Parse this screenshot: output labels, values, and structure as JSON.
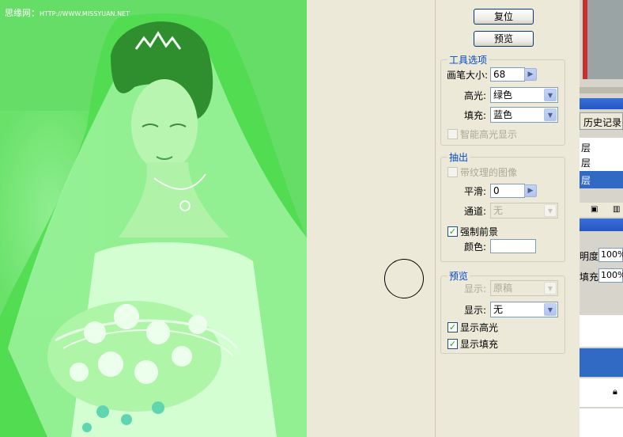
{
  "canvas": {
    "watermark_name": "思缘网：",
    "watermark_url": "HTTP://WWW.MISSYUAN.NET"
  },
  "dialog": {
    "reset_label": "复位",
    "preview_label": "预览",
    "tool_options": {
      "title": "工具选项",
      "brush_size_label": "画笔大小:",
      "brush_size_value": "68",
      "highlight_label": "高光:",
      "highlight_value": "绿色",
      "fill_label": "填充:",
      "fill_value": "蓝色",
      "smart_highlight_label": "智能高光显示",
      "smart_highlight_checked": false
    },
    "extraction": {
      "title": "抽出",
      "textured_label": "带纹理的图像",
      "textured_checked": false,
      "smooth_label": "平滑:",
      "smooth_value": "0",
      "channel_label": "通道:",
      "channel_value": "无",
      "force_fg_label": "强制前景",
      "force_fg_checked": true,
      "color_label": "颜色:"
    },
    "preview": {
      "title": "预览",
      "show1_label": "显示:",
      "show1_value": "原稿",
      "show2_label": "显示:",
      "show2_value": "无",
      "show_highlight_label": "显示高光",
      "show_highlight_checked": true,
      "show_fill_label": "显示填充",
      "show_fill_checked": true
    }
  },
  "side": {
    "history_tab": "历史记录",
    "layer1": "层",
    "layer2": "层",
    "layer3": "层",
    "opacity_label": "明度:",
    "opacity_value": "100%",
    "fill_label": "填充:",
    "fill_value": "100%"
  },
  "colors": {
    "highlight_green": "#5fe05f",
    "selection_blue": "#316ac5",
    "legend_blue": "#0046d5"
  }
}
